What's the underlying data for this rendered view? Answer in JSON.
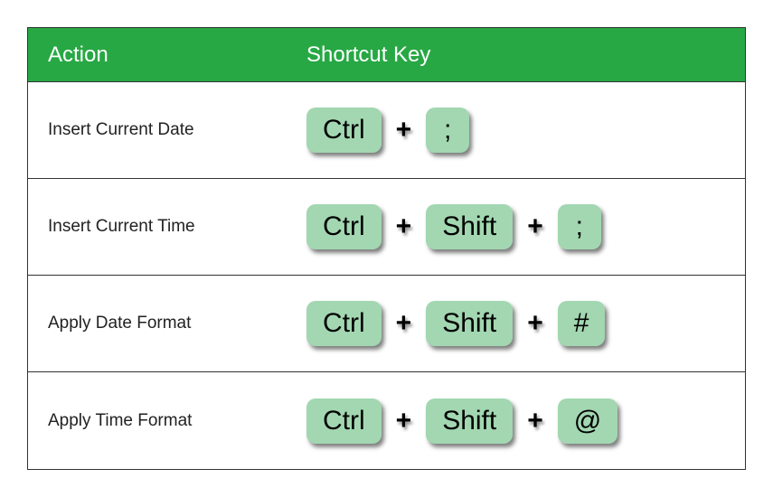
{
  "header": {
    "action_label": "Action",
    "shortcut_label": "Shortcut Key"
  },
  "plus_glyph": "+",
  "rows": [
    {
      "action": "Insert Current Date",
      "keys": [
        "Ctrl",
        ";"
      ]
    },
    {
      "action": "Insert Current Time",
      "keys": [
        "Ctrl",
        "Shift",
        ";"
      ]
    },
    {
      "action": "Apply Date Format",
      "keys": [
        "Ctrl",
        "Shift",
        "#"
      ]
    },
    {
      "action": "Apply Time Format",
      "keys": [
        "Ctrl",
        "Shift",
        "@"
      ]
    }
  ]
}
